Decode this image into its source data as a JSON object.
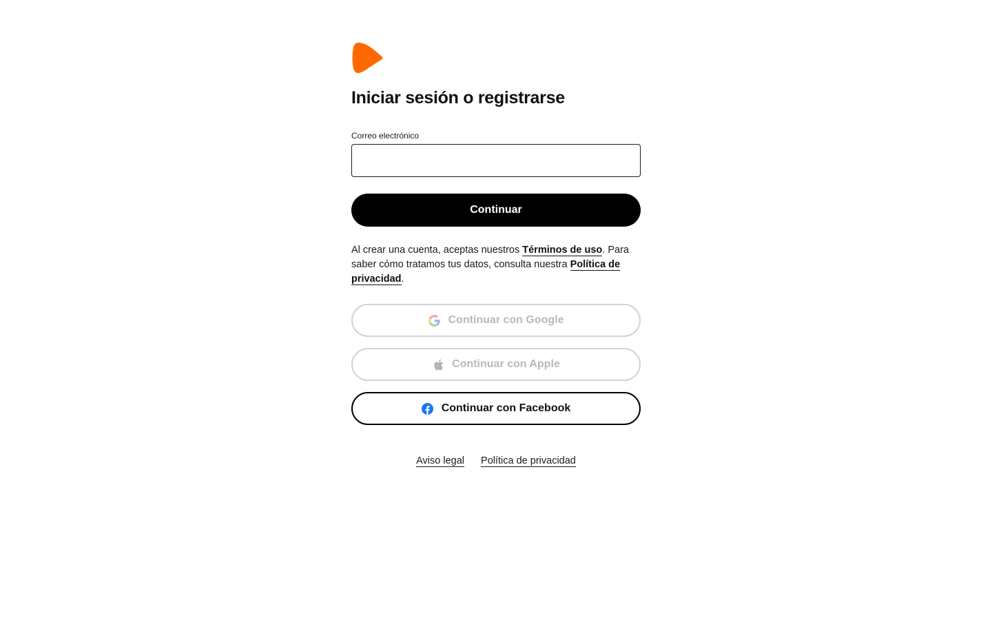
{
  "brand": {
    "logo_icon": "zalando-flag-icon",
    "accent_color": "#FF6900"
  },
  "header": {
    "title": "Iniciar sesión o registrarse"
  },
  "form": {
    "email_label": "Correo electrónico",
    "email_value": "",
    "continue_label": "Continuar"
  },
  "consent": {
    "prefix": "Al crear una cuenta, aceptas nuestros ",
    "terms_link": "Términos de uso",
    "middle": ". Para saber cómo tratamos tus datos, consulta nuestra ",
    "privacy_link": "Política de privacidad",
    "suffix": "."
  },
  "social": {
    "google_label": "Continuar con Google",
    "google_icon": "google-icon",
    "apple_label": "Continuar con Apple",
    "apple_icon": "apple-icon",
    "facebook_label": "Continuar con Facebook",
    "facebook_icon": "facebook-icon",
    "facebook_color": "#1877F2"
  },
  "footer": {
    "legal_link": "Aviso legal",
    "privacy_link": "Política de privacidad"
  }
}
